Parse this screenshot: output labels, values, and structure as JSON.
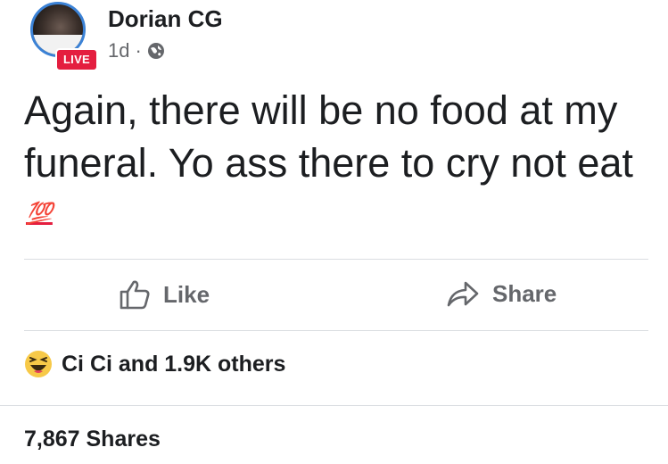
{
  "post": {
    "author": "Dorian CG",
    "live_badge": "LIVE",
    "time": "1d",
    "separator": "·",
    "privacy_icon": "globe-icon",
    "text": "Again, there will be no food at my funeral. Yo ass there to cry not eat",
    "emoji": "💯"
  },
  "actions": {
    "like_label": "Like",
    "share_label": "Share"
  },
  "reactions": {
    "icon": "laughing-emoji-icon",
    "text": "Ci Ci and 1.9K others"
  },
  "shares": {
    "text": "7,867 Shares"
  },
  "colors": {
    "live_red": "#e41e3f",
    "avatar_ring": "#3b82d6",
    "secondary_text": "#65676b"
  }
}
